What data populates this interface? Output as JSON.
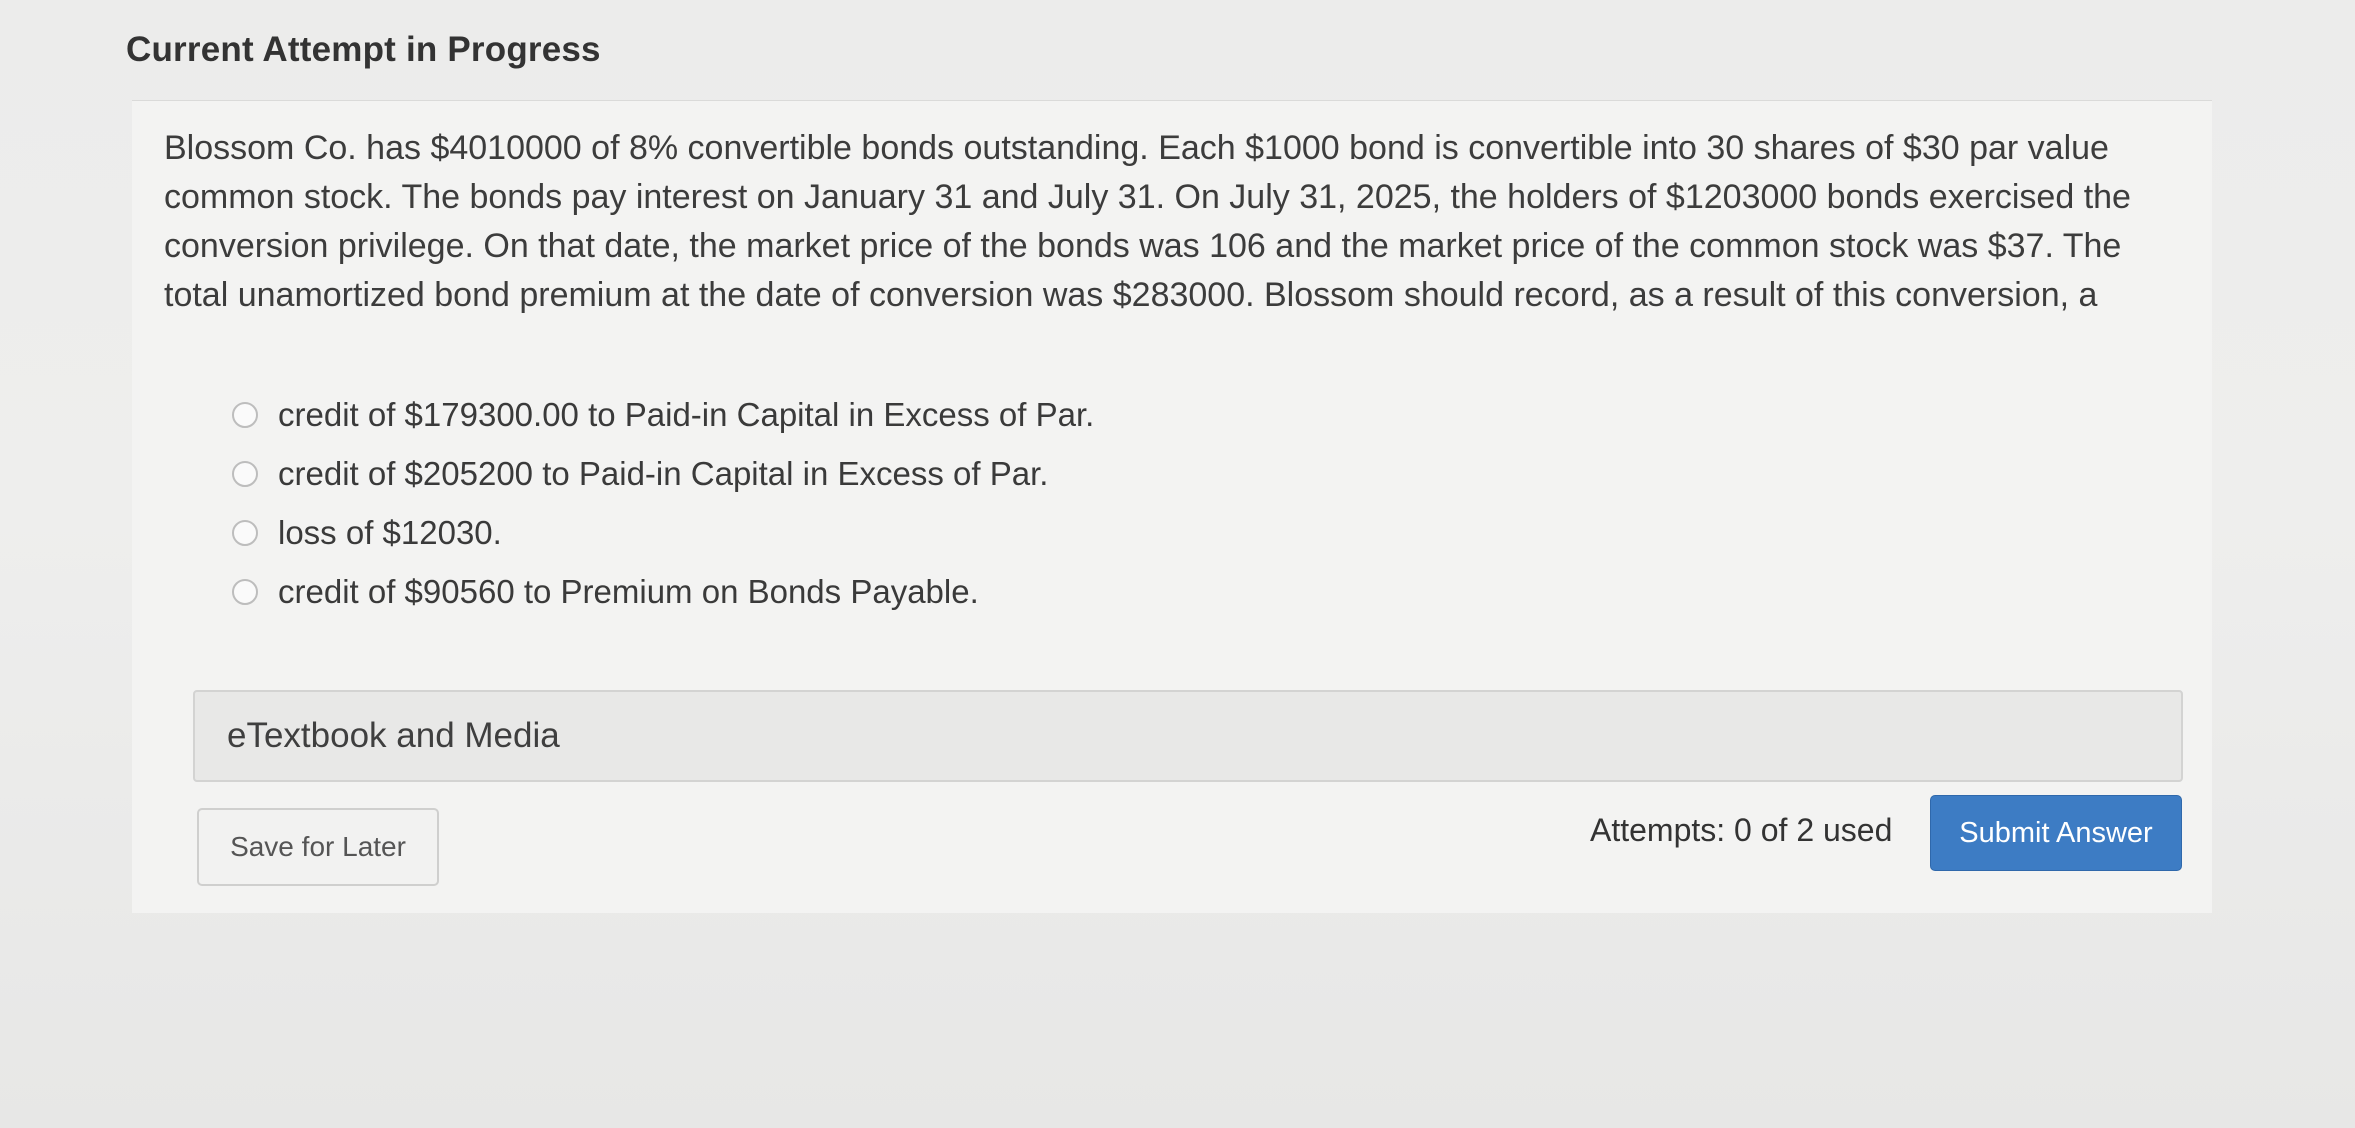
{
  "header": {
    "title": "Current Attempt in Progress"
  },
  "question": {
    "text": "Blossom Co. has $4010000 of 8% convertible bonds outstanding. Each $1000 bond is convertible into 30 shares of $30 par value common stock. The bonds pay interest on January 31 and July 31. On July 31, 2025, the holders of $1203000 bonds exercised the conversion privilege. On that date, the market price of the bonds was 106 and the market price of the common stock was $37. The total unamortized bond premium at the date of conversion was $283000. Blossom should record, as a result of this conversion, a"
  },
  "options": [
    {
      "label": "credit of $179300.00 to Paid-in Capital in Excess of Par."
    },
    {
      "label": "credit of $205200 to Paid-in Capital in Excess of Par."
    },
    {
      "label": "loss of $12030."
    },
    {
      "label": "credit of $90560 to Premium on Bonds Payable."
    }
  ],
  "resources": {
    "etextbook_label": "eTextbook and Media"
  },
  "footer": {
    "save_label": "Save for Later",
    "attempts_text": "Attempts: 0 of 2 used",
    "submit_label": "Submit Answer"
  },
  "colors": {
    "submit_button": "#3d7cc4",
    "background": "#ececeb"
  }
}
